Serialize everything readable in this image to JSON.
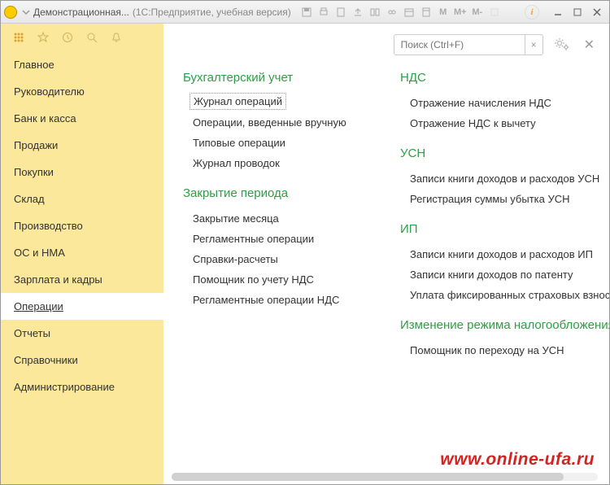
{
  "titlebar": {
    "logo": "1C",
    "title": "Демонстрационная...",
    "subtitle": "(1С:Предприятие, учебная версия)",
    "m1": "M",
    "m2": "M+",
    "m3": "M-"
  },
  "search": {
    "placeholder": "Поиск (Ctrl+F)",
    "clear": "×"
  },
  "sidebar": {
    "items": [
      {
        "label": "Главное"
      },
      {
        "label": "Руководителю"
      },
      {
        "label": "Банк и касса"
      },
      {
        "label": "Продажи"
      },
      {
        "label": "Покупки"
      },
      {
        "label": "Склад"
      },
      {
        "label": "Производство"
      },
      {
        "label": "ОС и НМА"
      },
      {
        "label": "Зарплата и кадры"
      },
      {
        "label": "Операции",
        "active": true
      },
      {
        "label": "Отчеты"
      },
      {
        "label": "Справочники"
      },
      {
        "label": "Администрирование"
      }
    ]
  },
  "sections": {
    "left": [
      {
        "title": "Бухгалтерский учет",
        "items": [
          {
            "label": "Журнал операций",
            "boxed": true
          },
          {
            "label": "Операции, введенные вручную"
          },
          {
            "label": "Типовые операции"
          },
          {
            "label": "Журнал проводок"
          }
        ]
      },
      {
        "title": "Закрытие периода",
        "items": [
          {
            "label": "Закрытие месяца"
          },
          {
            "label": "Регламентные операции"
          },
          {
            "label": "Справки-расчеты"
          },
          {
            "label": "Помощник по учету НДС"
          },
          {
            "label": "Регламентные операции НДС"
          }
        ]
      }
    ],
    "right": [
      {
        "title": "НДС",
        "items": [
          {
            "label": "Отражение начисления НДС"
          },
          {
            "label": "Отражение НДС к вычету"
          }
        ]
      },
      {
        "title": "УСН",
        "items": [
          {
            "label": "Записи книги доходов и расходов УСН"
          },
          {
            "label": "Регистрация суммы убытка УСН"
          }
        ]
      },
      {
        "title": "ИП",
        "items": [
          {
            "label": "Записи книги доходов и расходов ИП"
          },
          {
            "label": "Записи книги доходов по патенту"
          },
          {
            "label": "Уплата фиксированных страховых взносов"
          }
        ]
      },
      {
        "title": "Изменение режима налогообложения",
        "items": [
          {
            "label": "Помощник по переходу на УСН"
          }
        ]
      }
    ]
  },
  "watermark": "www.online-ufa.ru"
}
